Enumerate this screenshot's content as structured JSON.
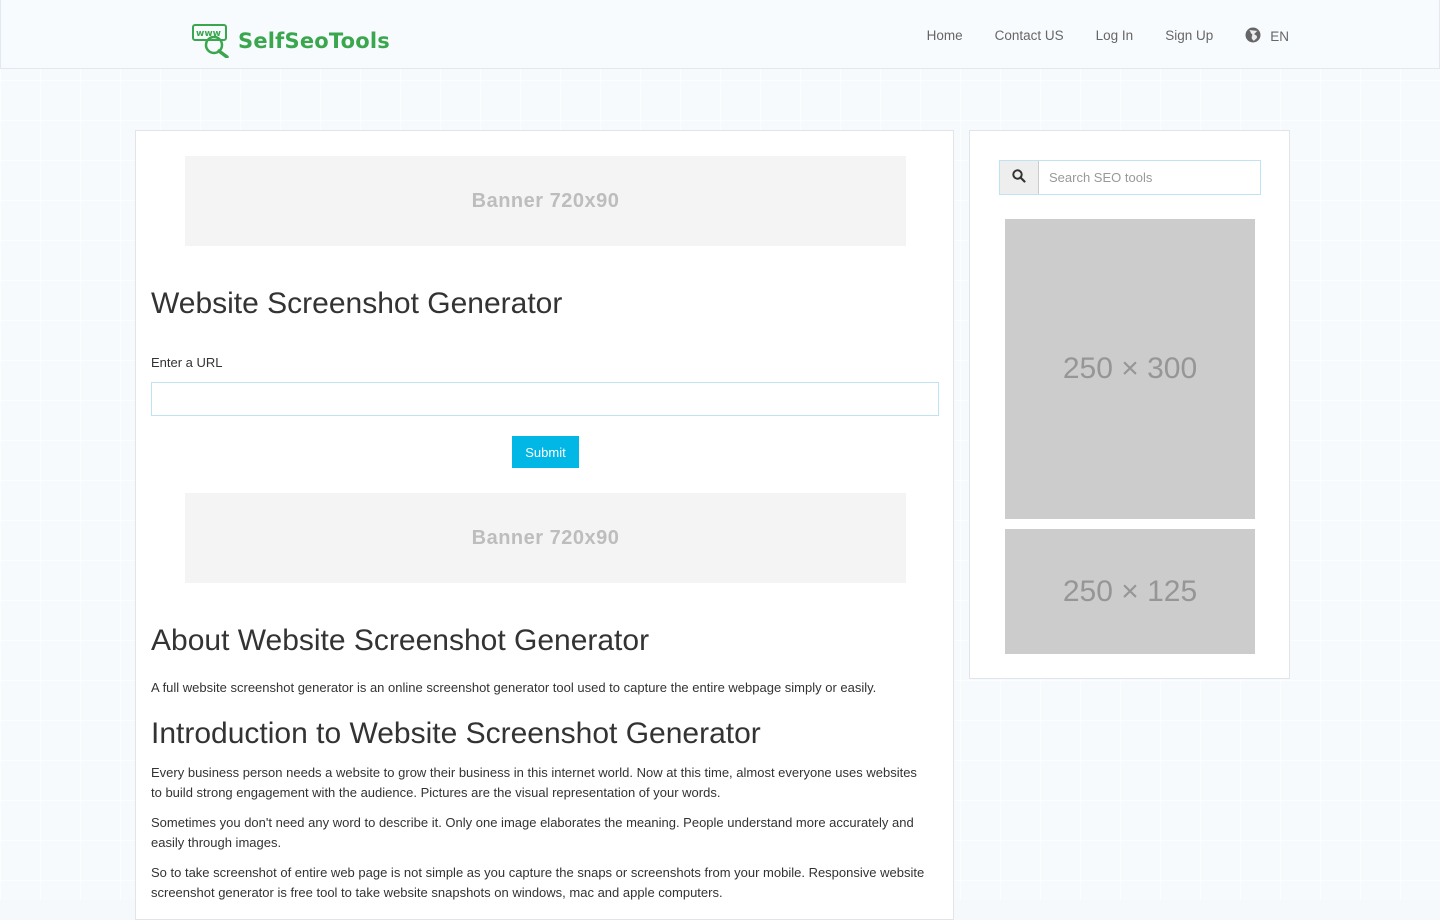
{
  "brand": {
    "logo_icon_text": "www",
    "name": "SelfSeoTools",
    "accent": "#3aa64e"
  },
  "nav": {
    "home": "Home",
    "contact": "Contact US",
    "login": "Log In",
    "signup": "Sign Up",
    "language": "EN"
  },
  "banners": {
    "top": "Banner  720x90",
    "bottom": "Banner  720x90"
  },
  "tool": {
    "title": "Website Screenshot Generator",
    "url_label": "Enter a URL",
    "url_value": "",
    "url_placeholder": "",
    "submit_label": "Submit",
    "submit_color": "#00b7e6"
  },
  "about": {
    "title": "About Website Screenshot Generator",
    "text": "A full website screenshot generator is an online screenshot generator tool used to capture the entire webpage simply or easily."
  },
  "intro": {
    "title": "Introduction to Website Screenshot Generator",
    "paragraphs": [
      "Every business person needs a website to grow their business in this internet world. Now at this time, almost everyone uses websites to build strong engagement with the audience. Pictures are the visual representation of your words.",
      "Sometimes you don't need any word to describe it. Only one image elaborates the meaning. People understand more accurately and easily through images.",
      "So to take screenshot of entire web page is not simple as you capture the snaps or screenshots from your mobile. Responsive website screenshot generator is free tool to take website snapshots on windows, mac and apple computers."
    ]
  },
  "sidebar": {
    "search_placeholder": "Search SEO tools",
    "search_icon": "search-icon",
    "ad_big": "250 × 300",
    "ad_small": "250 × 125"
  }
}
